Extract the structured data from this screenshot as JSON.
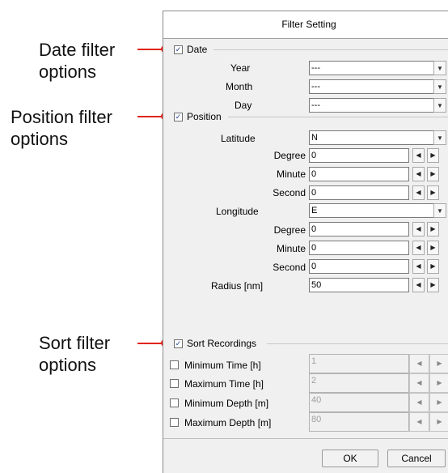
{
  "callouts": {
    "date": [
      "Date filter",
      "options"
    ],
    "position": [
      "Position filter",
      "options"
    ],
    "sort": [
      "Sort filter",
      "options"
    ]
  },
  "dialog": {
    "title": "Filter Setting",
    "date": {
      "label": "Date",
      "checked": true,
      "year_label": "Year",
      "year_value": "---",
      "month_label": "Month",
      "month_value": "---",
      "day_label": "Day",
      "day_value": "---"
    },
    "position": {
      "label": "Position",
      "checked": true,
      "latitude_label": "Latitude",
      "latitude_value": "N",
      "lat_degree_label": "Degree",
      "lat_degree_value": "0",
      "lat_minute_label": "Minute",
      "lat_minute_value": "0",
      "lat_second_label": "Second",
      "lat_second_value": "0",
      "longitude_label": "Longitude",
      "longitude_value": "E",
      "lon_degree_label": "Degree",
      "lon_degree_value": "0",
      "lon_minute_label": "Minute",
      "lon_minute_value": "0",
      "lon_second_label": "Second",
      "lon_second_value": "0",
      "radius_label": "Radius [nm]",
      "radius_value": "50"
    },
    "sort": {
      "label": "Sort Recordings",
      "checked": true,
      "min_time_label": "Minimum Time [h]",
      "min_time_value": "1",
      "max_time_label": "Maximum Time [h]",
      "max_time_value": "2",
      "min_depth_label": "Minimum Depth [m]",
      "min_depth_value": "40",
      "max_depth_label": "Maximum Depth [m]",
      "max_depth_value": "80"
    },
    "ok_label": "OK",
    "cancel_label": "Cancel"
  },
  "glyphs": {
    "check": "✓",
    "down": "▼",
    "left": "◀",
    "right": "▶"
  },
  "colors": {
    "callout_line": "#e1251b",
    "check_mark": "#1b3a8f"
  }
}
